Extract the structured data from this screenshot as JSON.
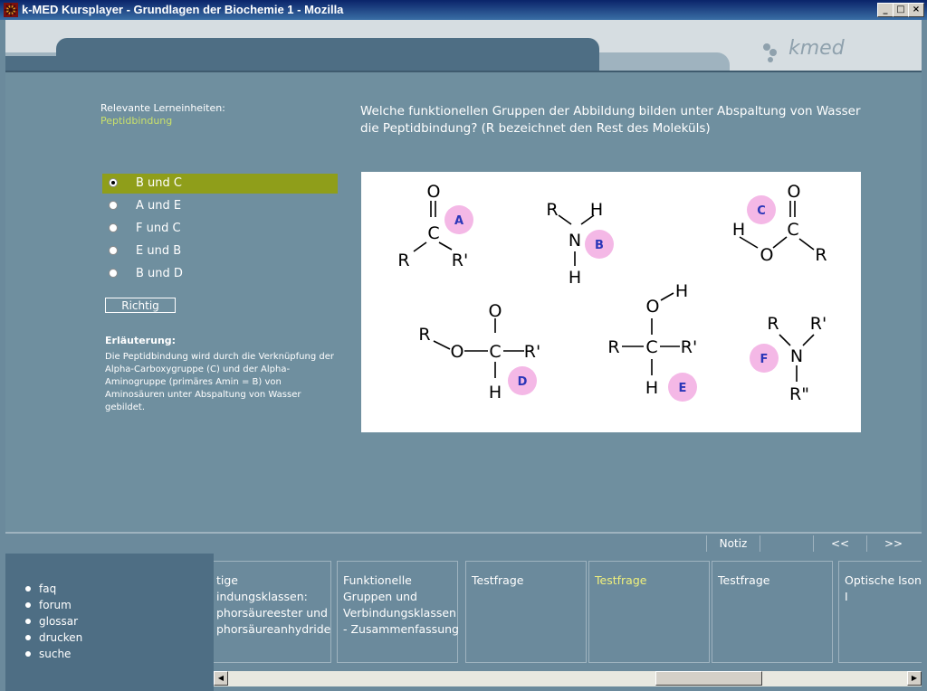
{
  "window": {
    "title": "k-MED Kursplayer - Grundlagen der Biochemie 1 - Mozilla",
    "minimize": "_",
    "maximize": "□",
    "close": "×"
  },
  "brand": {
    "name": "kmed"
  },
  "colors": {
    "accent": "#8f9e1a",
    "link": "#c9e06a",
    "bubble": "#f4b8e6",
    "bubble_text": "#2b36b8"
  },
  "lesson": {
    "relevant_label": "Relevante Lerneinheiten:",
    "relevant_link": "Peptidbindung"
  },
  "question": "Welche funktionellen Gruppen der Abbildung bilden unter Abspaltung von Wasser die Peptidbindung? (R bezeichnet den Rest des Moleküls)",
  "options": [
    {
      "label": "B und C",
      "selected": true
    },
    {
      "label": "A und E",
      "selected": false
    },
    {
      "label": "F und C",
      "selected": false
    },
    {
      "label": "E und B",
      "selected": false
    },
    {
      "label": "B und D",
      "selected": false
    }
  ],
  "result_button": "Richtig",
  "explanation": {
    "title": "Erläuterung:",
    "text": "Die Peptidbindung wird durch die Verknüpfung der Alpha-Carboxygruppe (C) und der Alpha-Aminogruppe (primäres Amin = B) von Aminosäuren unter Abspaltung von Wasser gebildet."
  },
  "diagram": {
    "A": {
      "tag": "A",
      "O": "O",
      "C": "C",
      "R1": "R",
      "R2": "R'"
    },
    "B": {
      "tag": "B",
      "R": "R",
      "H1": "H",
      "N": "N",
      "H2": "H"
    },
    "C": {
      "tag": "C",
      "O1": "O",
      "H": "H",
      "C": "C",
      "O2": "O",
      "R": "R"
    },
    "D": {
      "tag": "D",
      "R": "R",
      "O1": "O",
      "C": "C",
      "O2": "O",
      "R2": "R'",
      "H": "H"
    },
    "E": {
      "tag": "E",
      "O": "O",
      "H1": "H",
      "R": "R",
      "C": "C",
      "R2": "R'",
      "H2": "H"
    },
    "F": {
      "tag": "F",
      "R1": "R",
      "R2": "R'",
      "N": "N",
      "R3": "R\""
    }
  },
  "nav": {
    "note": "Notiz",
    "prev": "<<",
    "next": ">>"
  },
  "sidebar": {
    "items": [
      "faq",
      "forum",
      "glossar",
      "drucken",
      "suche"
    ]
  },
  "cards": [
    {
      "text": "tige\nindungsklassen:\nphorsäureester und\nphorsäureanhydride",
      "active": false
    },
    {
      "text": "Funktionelle\nGruppen und\nVerbindungsklassen\n- Zusammenfassung",
      "active": false
    },
    {
      "text": "Testfrage",
      "active": false
    },
    {
      "text": "Testfrage",
      "active": true
    },
    {
      "text": "Testfrage",
      "active": false
    },
    {
      "text": "Optische Ison\nI",
      "active": false
    }
  ],
  "scroll": {
    "left": "◀",
    "right": "▶"
  }
}
